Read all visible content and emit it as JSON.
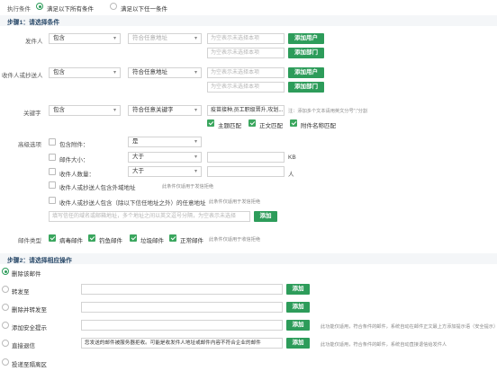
{
  "exec": {
    "label": "执行条件",
    "opt_all": "满足以下所有条件",
    "opt_any": "满足以下任一条件"
  },
  "step1": {
    "title": "步骤1：请选择条件",
    "sender": {
      "label": "发件人",
      "mode": "包含",
      "match": "符合任意地址",
      "ph1": "为空表示未选择本项",
      "ph2": "为空表示未选择本项",
      "add_user": "添加用户",
      "add_dept": "添加部门"
    },
    "recipient": {
      "label": "收件人或抄送人",
      "mode": "包含",
      "match": "符合任意地址",
      "ph1": "为空表示未选择本项",
      "ph2": "为空表示未选择本项",
      "add_user": "添加用户",
      "add_dept": "添加部门"
    },
    "keyword": {
      "label": "关键字",
      "mode": "包含",
      "match": "符合任意关键字",
      "value": "疫苗接种,员工职级晋升,攻划...",
      "note": "注：添加多个文本请用英文分号\";\"分割",
      "opts": [
        "主题匹配",
        "正文匹配",
        "附件名称匹配"
      ]
    },
    "advanced": {
      "label": "高级选项",
      "has_attach_label": "包含附件：",
      "has_attach_value": "是",
      "size_label": "邮件大小：",
      "size_op": "大于",
      "size_unit": "KB",
      "count_label": "收件人数量：",
      "count_op": "大于",
      "count_unit": "人",
      "external_label": "收件人或抄送人包含外域地址",
      "external_note": "此条件仅适用于发信拒绝",
      "except_label": "收件人或抄送人包含（除以下信任地址之外）的任意地址",
      "except_note": "此条件仅适用于发信拒绝",
      "except_ph": "填写信任的域名或邮箱地址，多个地址之间以英文逗号分隔，为空表示未选择",
      "add_btn": "添加"
    },
    "mail_type": {
      "label": "邮件类型",
      "opts": [
        "病毒邮件",
        "钓鱼邮件",
        "垃圾邮件",
        "正常邮件"
      ],
      "note": "此条件仅适用于收信拒绝"
    }
  },
  "step2": {
    "title": "步骤2：请选择相应操作",
    "actions": [
      {
        "label": "删除该邮件"
      },
      {
        "label": "转发至",
        "btn": "添加"
      },
      {
        "label": "删除并转发至",
        "btn": "添加"
      },
      {
        "label": "添加安全提示",
        "btn": "添加",
        "note": "此功能仅适用，符合条件的邮件，系统自动在邮件正文最上方添加提示语（安全提示）"
      },
      {
        "label": "直接退信",
        "btn": "添加",
        "value": "您发送的邮件被服务器拒收。可能是收发件人地址或邮件内容不符合企业的邮件",
        "note": "此功能仅适用，符合条件的邮件，系统自动直接退信给发件人"
      },
      {
        "label": "投递至隔离区"
      }
    ]
  }
}
